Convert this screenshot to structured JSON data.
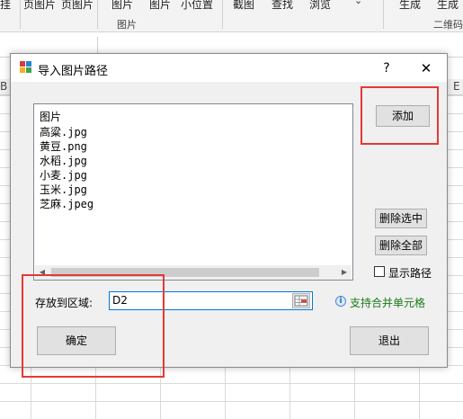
{
  "ribbon": {
    "items": [
      "挂",
      "页图片",
      "页图片",
      "图片",
      "图片",
      "小位置",
      "截图",
      "查找",
      "浏览",
      "生成",
      "生成"
    ],
    "groups": [
      "图片",
      "二维码"
    ]
  },
  "dialog": {
    "title": "导入图片路径",
    "help_label": "?",
    "close_label": "✕",
    "list": {
      "header": "图片",
      "items": [
        "高粱.jpg",
        "黄豆.png",
        "水稻.jpg",
        "小麦.jpg",
        "玉米.jpg",
        "芝麻.jpeg"
      ]
    },
    "buttons": {
      "add": "添加",
      "delete_selected": "删除选中",
      "delete_all": "删除全部",
      "ok": "确定",
      "exit": "退出"
    },
    "show_path": {
      "label": "显示路径",
      "checked": false
    },
    "range": {
      "label": "存放到区域:",
      "value": "D2"
    },
    "info": "支持合并单元格"
  },
  "colors": {
    "highlight": "#e53935",
    "info_text": "#1a7a1a",
    "input_border": "#0078d7"
  }
}
